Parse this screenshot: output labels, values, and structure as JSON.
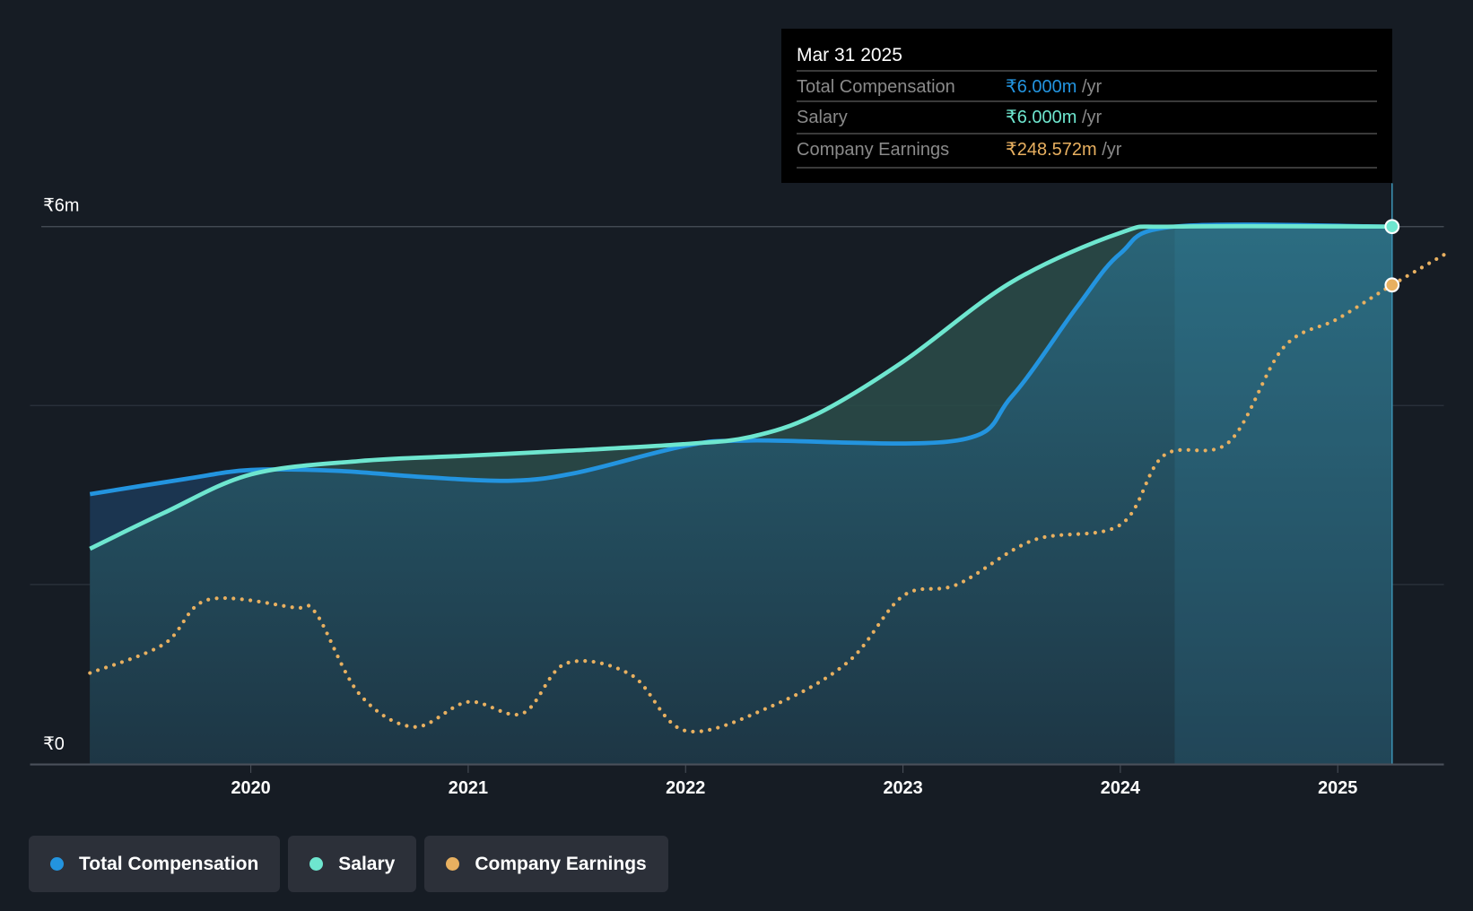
{
  "chart_data": {
    "type": "line",
    "title": "",
    "y_axis": {
      "label": "",
      "ticks": [
        "₹0",
        "₹6m"
      ],
      "range_m": [
        0,
        6
      ]
    },
    "x_axis": {
      "ticks": [
        "2020",
        "2021",
        "2022",
        "2023",
        "2024",
        "2025"
      ],
      "range": [
        2019.0,
        2025.5
      ]
    },
    "series": [
      {
        "name": "Total Compensation",
        "color": "#2394df",
        "unit": "₹m",
        "points": [
          [
            2019.26,
            3.01
          ],
          [
            2019.7,
            3.18
          ],
          [
            2020.0,
            3.28
          ],
          [
            2020.4,
            3.27
          ],
          [
            2020.8,
            3.2
          ],
          [
            2021.2,
            3.16
          ],
          [
            2021.5,
            3.25
          ],
          [
            2022.0,
            3.55
          ],
          [
            2022.3,
            3.61
          ],
          [
            2023.25,
            3.61
          ],
          [
            2023.5,
            4.1
          ],
          [
            2023.8,
            5.1
          ],
          [
            2024.0,
            5.7
          ],
          [
            2024.25,
            6.0
          ],
          [
            2025.25,
            6.0
          ]
        ]
      },
      {
        "name": "Salary",
        "color": "#6ee6cf",
        "unit": "₹m",
        "points": [
          [
            2019.26,
            2.4
          ],
          [
            2019.6,
            2.8
          ],
          [
            2020.0,
            3.23
          ],
          [
            2020.5,
            3.38
          ],
          [
            2021.0,
            3.44
          ],
          [
            2021.5,
            3.5
          ],
          [
            2022.0,
            3.57
          ],
          [
            2022.3,
            3.65
          ],
          [
            2022.6,
            3.9
          ],
          [
            2023.0,
            4.49
          ],
          [
            2023.5,
            5.38
          ],
          [
            2024.0,
            5.93
          ],
          [
            2024.25,
            6.0
          ],
          [
            2025.25,
            6.0
          ]
        ]
      },
      {
        "name": "Company Earnings",
        "color": "#e8b060",
        "unit": "₹m",
        "style": "dotted",
        "axis_max": 279,
        "points": [
          [
            2019.26,
            47
          ],
          [
            2019.6,
            62
          ],
          [
            2019.8,
            85
          ],
          [
            2020.2,
            81
          ],
          [
            2020.3,
            78
          ],
          [
            2020.5,
            36
          ],
          [
            2020.75,
            19
          ],
          [
            2021.0,
            32
          ],
          [
            2021.25,
            26
          ],
          [
            2021.45,
            52
          ],
          [
            2021.75,
            46
          ],
          [
            2022.0,
            17
          ],
          [
            2022.4,
            30
          ],
          [
            2022.75,
            53
          ],
          [
            2023.0,
            87
          ],
          [
            2023.25,
            93
          ],
          [
            2023.6,
            116
          ],
          [
            2024.0,
            124
          ],
          [
            2024.2,
            160
          ],
          [
            2024.5,
            167
          ],
          [
            2024.75,
            216
          ],
          [
            2025.0,
            231
          ],
          [
            2025.25,
            248.572
          ],
          [
            2025.5,
            265
          ]
        ]
      }
    ],
    "highlight_from": 2024.25,
    "legend": [
      "Total Compensation",
      "Salary",
      "Company Earnings"
    ],
    "legend_position": "bottom-left"
  },
  "tooltip": {
    "date": "Mar 31 2025",
    "rows": [
      {
        "label": "Total Compensation",
        "value": "₹6.000m",
        "unit": "/yr",
        "color": "#2394df"
      },
      {
        "label": "Salary",
        "value": "₹6.000m",
        "unit": "/yr",
        "color": "#6ee6cf"
      },
      {
        "label": "Company Earnings",
        "value": "₹248.572m",
        "unit": "/yr",
        "color": "#e8b060"
      }
    ]
  }
}
